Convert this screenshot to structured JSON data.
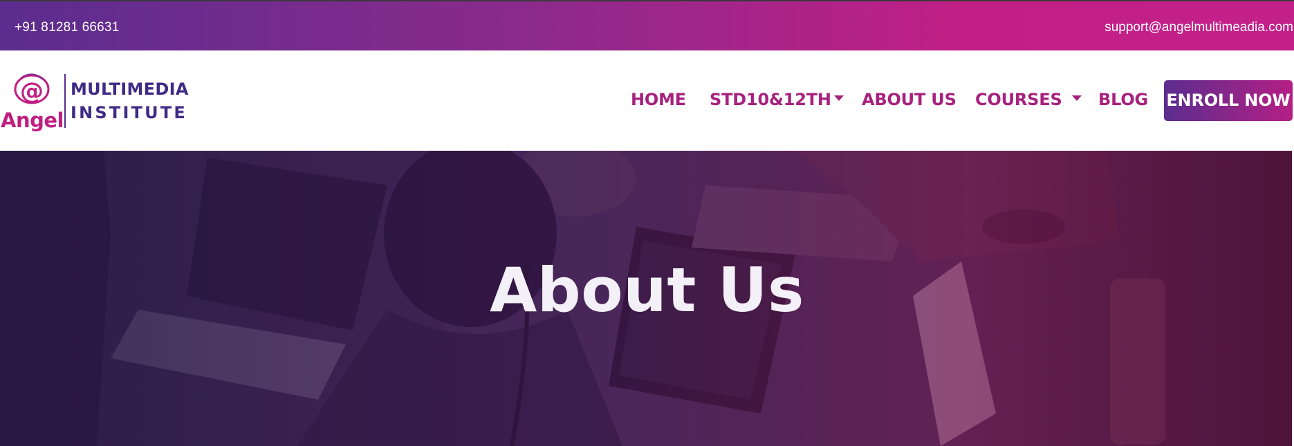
{
  "topbar": {
    "phone": "+91 81281 66631",
    "email": "support@angelmultimeadia.com"
  },
  "logo": {
    "at_symbol": "@",
    "brand": "Angel",
    "line1": "MULTIMEDIA",
    "line2": "INSTITUTE"
  },
  "nav": {
    "items": [
      {
        "label": "HOME",
        "has_dropdown": false
      },
      {
        "label": "STD10&12TH",
        "has_dropdown": true
      },
      {
        "label": "ABOUT US",
        "has_dropdown": false
      },
      {
        "label": "COURSES",
        "has_dropdown": true
      },
      {
        "label": "BLOG",
        "has_dropdown": false
      }
    ],
    "cta_label": "ENROLL NOW"
  },
  "hero": {
    "title": "About Us"
  },
  "colors": {
    "brand_purple": "#5b2d8e",
    "brand_magenta": "#c21f86",
    "nav_text": "#a7217e",
    "white": "#ffffff"
  },
  "icons": {
    "dropdown": "caret-down-icon",
    "logo_mark": "at-sign-icon"
  }
}
